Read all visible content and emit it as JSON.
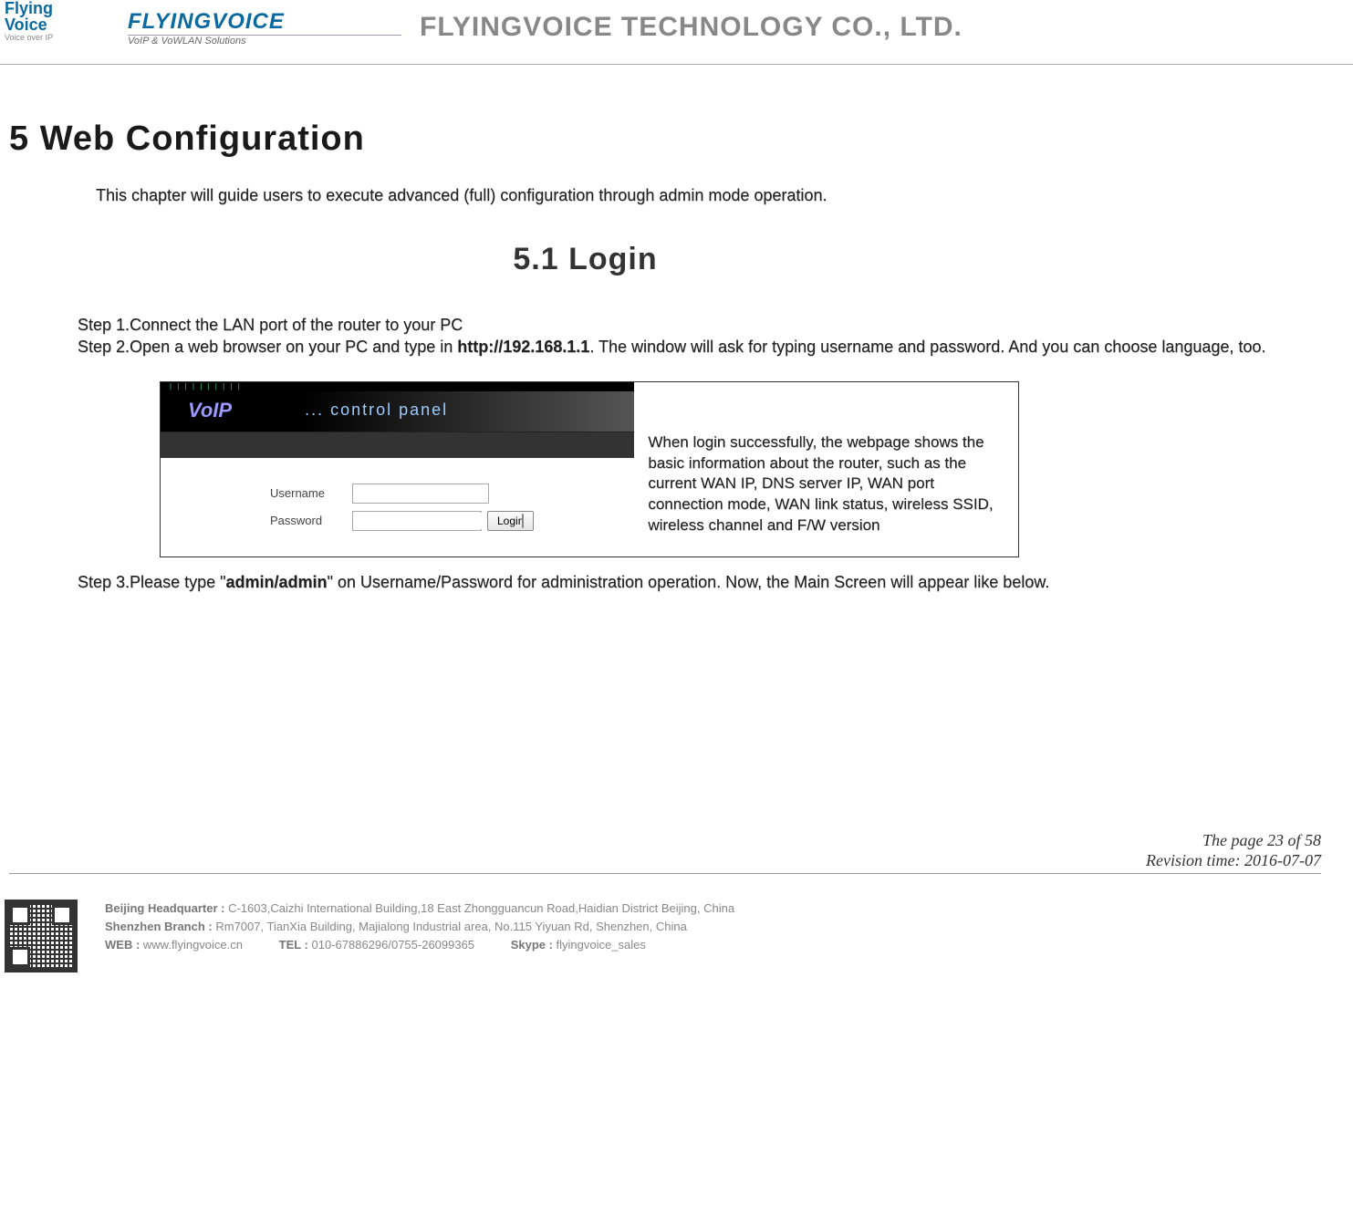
{
  "header": {
    "logo1_main": "Flying",
    "logo1_main2": "Voice",
    "logo1_sub": "Voice over IP",
    "logo2_main": "FLYINGVOICE",
    "logo2_sub": "VoIP & VoWLAN Solutions",
    "company": "FLYINGVOICE TECHNOLOGY CO., LTD."
  },
  "main": {
    "h1": "5   Web Configuration",
    "intro": "This chapter will guide users to execute advanced (full) configuration through admin mode operation.",
    "h2": "5.1  Login",
    "step1": "Step 1.Connect the LAN port of the router to your PC",
    "step2_pre": "Step 2.Open a web browser on your PC and type in ",
    "step2_url": "http://192.168.1.1",
    "step2_post": ". The window will ask for typing username and password. And you can choose language, too.",
    "step3_pre": "Step 3.Please type \"",
    "step3_bold": "admin/admin",
    "step3_post": "\" on Username/Password for administration operation. Now, the Main Screen will appear like below."
  },
  "panel": {
    "voip": "VoIP",
    "ctrl": "... control panel",
    "username_label": "Username",
    "password_label": "Password",
    "username_value": "",
    "password_value": "",
    "login_btn": "Login",
    "note": "When login successfully, the webpage shows the basic information about the router, such as the current WAN IP, DNS server IP, WAN port connection mode, WAN link status, wireless SSID, wireless channel and F/W version"
  },
  "page_info": {
    "page": "The page 23 of 58",
    "revision": "Revision time: 2016-07-07"
  },
  "footer": {
    "bj_label": "Beijing Headquarter  : ",
    "bj_value": "C-1603,Caizhi International Building,18 East Zhongguancun Road,Haidian District Beijing, China",
    "sz_label": "Shenzhen Branch : ",
    "sz_value": "Rm7007, TianXia Building, Majialong Industrial area, No.115 Yiyuan Rd, Shenzhen, China",
    "web_label": "WEB : ",
    "web_value": "www.flyingvoice.cn",
    "tel_label": "TEL : ",
    "tel_value": "010-67886296/0755-26099365",
    "skype_label": "Skype : ",
    "skype_value": "flyingvoice_sales"
  }
}
